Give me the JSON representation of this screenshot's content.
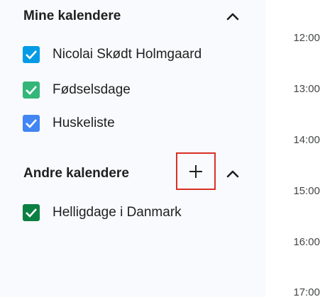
{
  "my_calendars": {
    "title": "Mine kalendere",
    "items": [
      {
        "label": "Nicolai Skødt Holmgaard",
        "checked": true,
        "color": "#039be5"
      },
      {
        "label": "Fødselsdage",
        "checked": true,
        "color": "#33b679"
      },
      {
        "label": "Huskeliste",
        "checked": true,
        "color": "#4285f4"
      }
    ]
  },
  "other_calendars": {
    "title": "Andre kalendere",
    "add_icon": "plus-icon",
    "items": [
      {
        "label": "Helligdage i Danmark",
        "checked": true,
        "color": "#0b8043"
      }
    ]
  },
  "time_labels": [
    "12:00",
    "13:00",
    "14:00",
    "15:00",
    "16:00",
    "17:00"
  ],
  "colors": {
    "sidebar_bg": "#f8fafd",
    "highlight": "#d93025"
  }
}
